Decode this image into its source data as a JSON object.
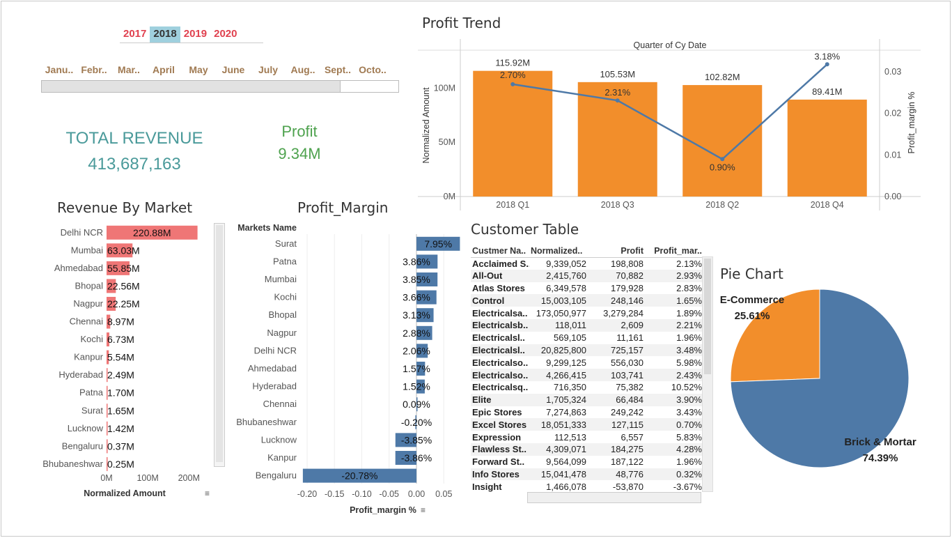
{
  "filters": {
    "years": [
      {
        "label": "2017",
        "selected": false
      },
      {
        "label": "2018",
        "selected": true
      },
      {
        "label": "2019",
        "selected": false
      },
      {
        "label": "2020",
        "selected": false
      }
    ],
    "months": [
      "Janu..",
      "Febr..",
      "Mar..",
      "April",
      "May",
      "June",
      "July",
      "Aug..",
      "Sept..",
      "Octo.."
    ]
  },
  "kpis": {
    "total_revenue_label": "TOTAL REVENUE",
    "total_revenue_value": "413,687,163",
    "profit_label": "Profit",
    "profit_value": "9.34M"
  },
  "colors": {
    "orange": "#f28e2b",
    "blue": "#4e79a7",
    "salmon": "#ef7676",
    "teal": "#4a9a9a",
    "green": "#4ea24e",
    "year_red": "#e0414f",
    "month_brown": "#a07a52"
  },
  "profit_trend": {
    "title": "Profit Trend",
    "chart_data": {
      "type": "bar",
      "title": "Profit Trend",
      "header": "Quarter of Cy Date",
      "categories": [
        "2018 Q1",
        "2018 Q3",
        "2018 Q2",
        "2018 Q4"
      ],
      "series": [
        {
          "name": "Normalized Amount",
          "values": [
            115.92,
            105.53,
            102.82,
            89.41
          ],
          "labels": [
            "115.92M",
            "105.53M",
            "102.82M",
            "89.41M"
          ]
        },
        {
          "name": "Profit_margin %",
          "values": [
            0.027,
            0.0231,
            0.009,
            0.0318
          ],
          "labels": [
            "2.70%",
            "2.31%",
            "0.90%",
            "3.18%"
          ]
        }
      ],
      "ylabel": "Normalized Amount",
      "y2label": "Profit_margin %",
      "yticks": [
        "0M",
        "50M",
        "100M"
      ],
      "ylim": [
        0,
        135
      ],
      "y2ticks": [
        "0.00",
        "0.01",
        "0.02",
        "0.03"
      ],
      "y2lim": [
        0,
        0.0352
      ]
    }
  },
  "revenue_by_market": {
    "title": "Revenue By Market",
    "chart_data": {
      "type": "bar",
      "title": "Revenue By Market",
      "categories": [
        "Delhi NCR",
        "Mumbai",
        "Ahmedabad",
        "Bhopal",
        "Nagpur",
        "Chennai",
        "Kochi",
        "Kanpur",
        "Hyderabad",
        "Patna",
        "Surat",
        "Lucknow",
        "Bengaluru",
        "Bhubaneshwar"
      ],
      "values": [
        220.88,
        63.03,
        55.85,
        22.56,
        22.25,
        8.97,
        6.73,
        5.54,
        2.49,
        1.7,
        1.65,
        1.42,
        0.37,
        0.25
      ],
      "labels": [
        "220.88M",
        "63.03M",
        "55.85M",
        "22.56M",
        "22.25M",
        "8.97M",
        "6.73M",
        "5.54M",
        "2.49M",
        "1.70M",
        "1.65M",
        "1.42M",
        "0.37M",
        "0.25M"
      ],
      "xlabel": "Normalized Amount",
      "xticks": [
        "0M",
        "100M",
        "200M"
      ],
      "xlim": [
        0,
        240
      ]
    }
  },
  "profit_margin": {
    "title": "Profit_Margin",
    "header": "Markets Name",
    "chart_data": {
      "type": "bar",
      "title": "Profit_Margin",
      "categories": [
        "Surat",
        "Patna",
        "Mumbai",
        "Kochi",
        "Bhopal",
        "Nagpur",
        "Delhi NCR",
        "Ahmedabad",
        "Hyderabad",
        "Chennai",
        "Bhubaneshwar",
        "Lucknow",
        "Kanpur",
        "Bengaluru"
      ],
      "values": [
        0.0795,
        0.0386,
        0.0385,
        0.0366,
        0.0313,
        0.0288,
        0.0206,
        0.0157,
        0.0152,
        0.0009,
        -0.002,
        -0.0385,
        -0.0386,
        -0.2078
      ],
      "labels": [
        "7.95%",
        "3.86%",
        "3.85%",
        "3.66%",
        "3.13%",
        "2.88%",
        "2.06%",
        "1.57%",
        "1.52%",
        "0.09%",
        "-0.20%",
        "-3.85%",
        "-3.86%",
        "-20.78%"
      ],
      "xlabel": "Profit_margin %",
      "xticks": [
        "-0.20",
        "-0.15",
        "-0.10",
        "-0.05",
        "0.00",
        "0.05"
      ],
      "xlim": [
        -0.21,
        0.08
      ]
    }
  },
  "customer_table": {
    "title": "Customer Table",
    "columns": [
      "Custmer Na..",
      "Normalized..",
      "Profit",
      "Profit_mar.."
    ],
    "rows": [
      [
        "Acclaimed S..",
        "9,339,052",
        "198,808",
        "2.13%"
      ],
      [
        "All-Out",
        "2,415,760",
        "70,882",
        "2.93%"
      ],
      [
        "Atlas Stores",
        "6,349,578",
        "179,928",
        "2.83%"
      ],
      [
        "Control",
        "15,003,105",
        "248,146",
        "1.65%"
      ],
      [
        "Electricalsa..",
        "173,050,977",
        "3,279,284",
        "1.89%"
      ],
      [
        "Electricalsb..",
        "118,011",
        "2,609",
        "2.21%"
      ],
      [
        "Electricalsl..",
        "569,105",
        "11,161",
        "1.96%"
      ],
      [
        "Electricalsl..",
        "20,825,800",
        "725,157",
        "3.48%"
      ],
      [
        "Electricalso..",
        "9,299,125",
        "556,030",
        "5.98%"
      ],
      [
        "Electricalso..",
        "4,266,415",
        "103,741",
        "2.43%"
      ],
      [
        "Electricalsq..",
        "716,350",
        "75,382",
        "10.52%"
      ],
      [
        "Elite",
        "1,705,324",
        "66,484",
        "3.90%"
      ],
      [
        "Epic Stores",
        "7,274,863",
        "249,242",
        "3.43%"
      ],
      [
        "Excel Stores",
        "18,051,333",
        "127,115",
        "0.70%"
      ],
      [
        "Expression",
        "112,513",
        "6,557",
        "5.83%"
      ],
      [
        "Flawless St..",
        "4,309,071",
        "184,275",
        "4.28%"
      ],
      [
        "Forward St..",
        "9,564,099",
        "187,122",
        "1.96%"
      ],
      [
        "Info Stores",
        "15,041,478",
        "48,776",
        "0.32%"
      ],
      [
        "Insight",
        "1,466,078",
        "-53,870",
        "-3.67%"
      ]
    ]
  },
  "pie": {
    "title": "Pie Chart",
    "chart_data": {
      "type": "pie",
      "title": "Pie Chart",
      "categories": [
        "E-Commerce",
        "Brick & Mortar"
      ],
      "values": [
        25.61,
        74.39
      ],
      "labels": [
        "25.61%",
        "74.39%"
      ]
    }
  }
}
